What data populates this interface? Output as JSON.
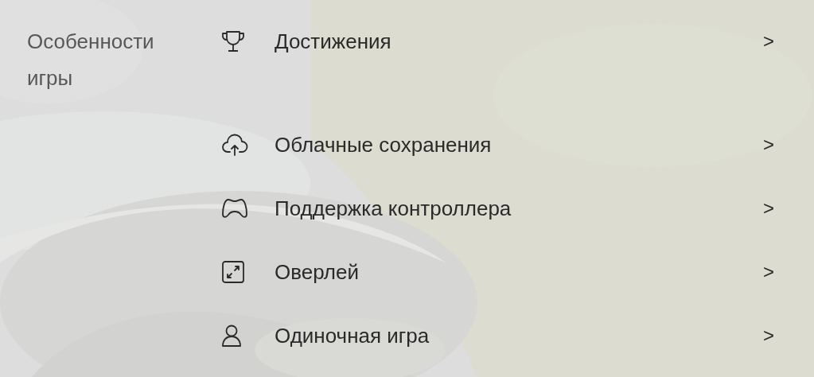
{
  "section": {
    "heading": "Особенности игры",
    "items": [
      {
        "kind": "trophy",
        "label": "Достижения",
        "chevron": ">"
      },
      {
        "kind": "cloud",
        "label": "Облачные сохранения",
        "chevron": ">"
      },
      {
        "kind": "controller",
        "label": "Поддержка контроллера",
        "chevron": ">"
      },
      {
        "kind": "overlay",
        "label": "Оверлей",
        "chevron": ">"
      },
      {
        "kind": "person",
        "label": "Одиночная игра",
        "chevron": ">"
      }
    ]
  }
}
